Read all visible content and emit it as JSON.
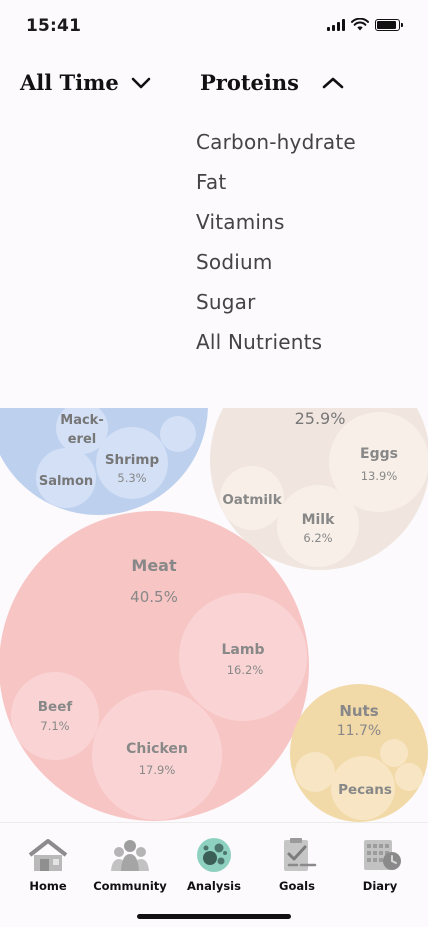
{
  "status_bar": {
    "time": "15:41"
  },
  "filters": {
    "time_range": "All Time",
    "nutrient": "Proteins"
  },
  "nutrient_menu": {
    "options": [
      "Carbon-hydrate",
      "Fat",
      "Vitamins",
      "Sodium",
      "Sugar",
      "All Nutrients"
    ]
  },
  "bubbles": {
    "seafood": {
      "items": [
        {
          "label": "Mack-\nerel",
          "percent": ""
        },
        {
          "label": "Shrimp",
          "percent": "5.3%"
        },
        {
          "label": "Salmon",
          "percent": ""
        }
      ]
    },
    "dairy": {
      "total": "25.9%",
      "items": [
        {
          "label": "Eggs",
          "percent": "13.9%"
        },
        {
          "label": "Oatmilk",
          "percent": ""
        },
        {
          "label": "Milk",
          "percent": "6.2%"
        }
      ]
    },
    "meat": {
      "label": "Meat",
      "percent": "40.5%",
      "items": [
        {
          "label": "Lamb",
          "percent": "16.2%"
        },
        {
          "label": "Beef",
          "percent": "7.1%"
        },
        {
          "label": "Chicken",
          "percent": "17.9%"
        }
      ]
    },
    "nuts": {
      "label": "Nuts",
      "percent": "11.7%",
      "items": [
        {
          "label": "Pecans",
          "percent": ""
        }
      ]
    }
  },
  "tabs": [
    {
      "label": "Home",
      "icon": "home-icon"
    },
    {
      "label": "Community",
      "icon": "community-icon"
    },
    {
      "label": "Analysis",
      "icon": "analysis-icon"
    },
    {
      "label": "Goals",
      "icon": "goals-icon"
    },
    {
      "label": "Diary",
      "icon": "diary-icon"
    }
  ],
  "colors": {
    "seafood": "#bdd0ee",
    "dairy": "#f0e6df",
    "meat": "#f8c5c5",
    "nuts": "#f2d9a8",
    "analysis_active": "#8ed1c0"
  }
}
